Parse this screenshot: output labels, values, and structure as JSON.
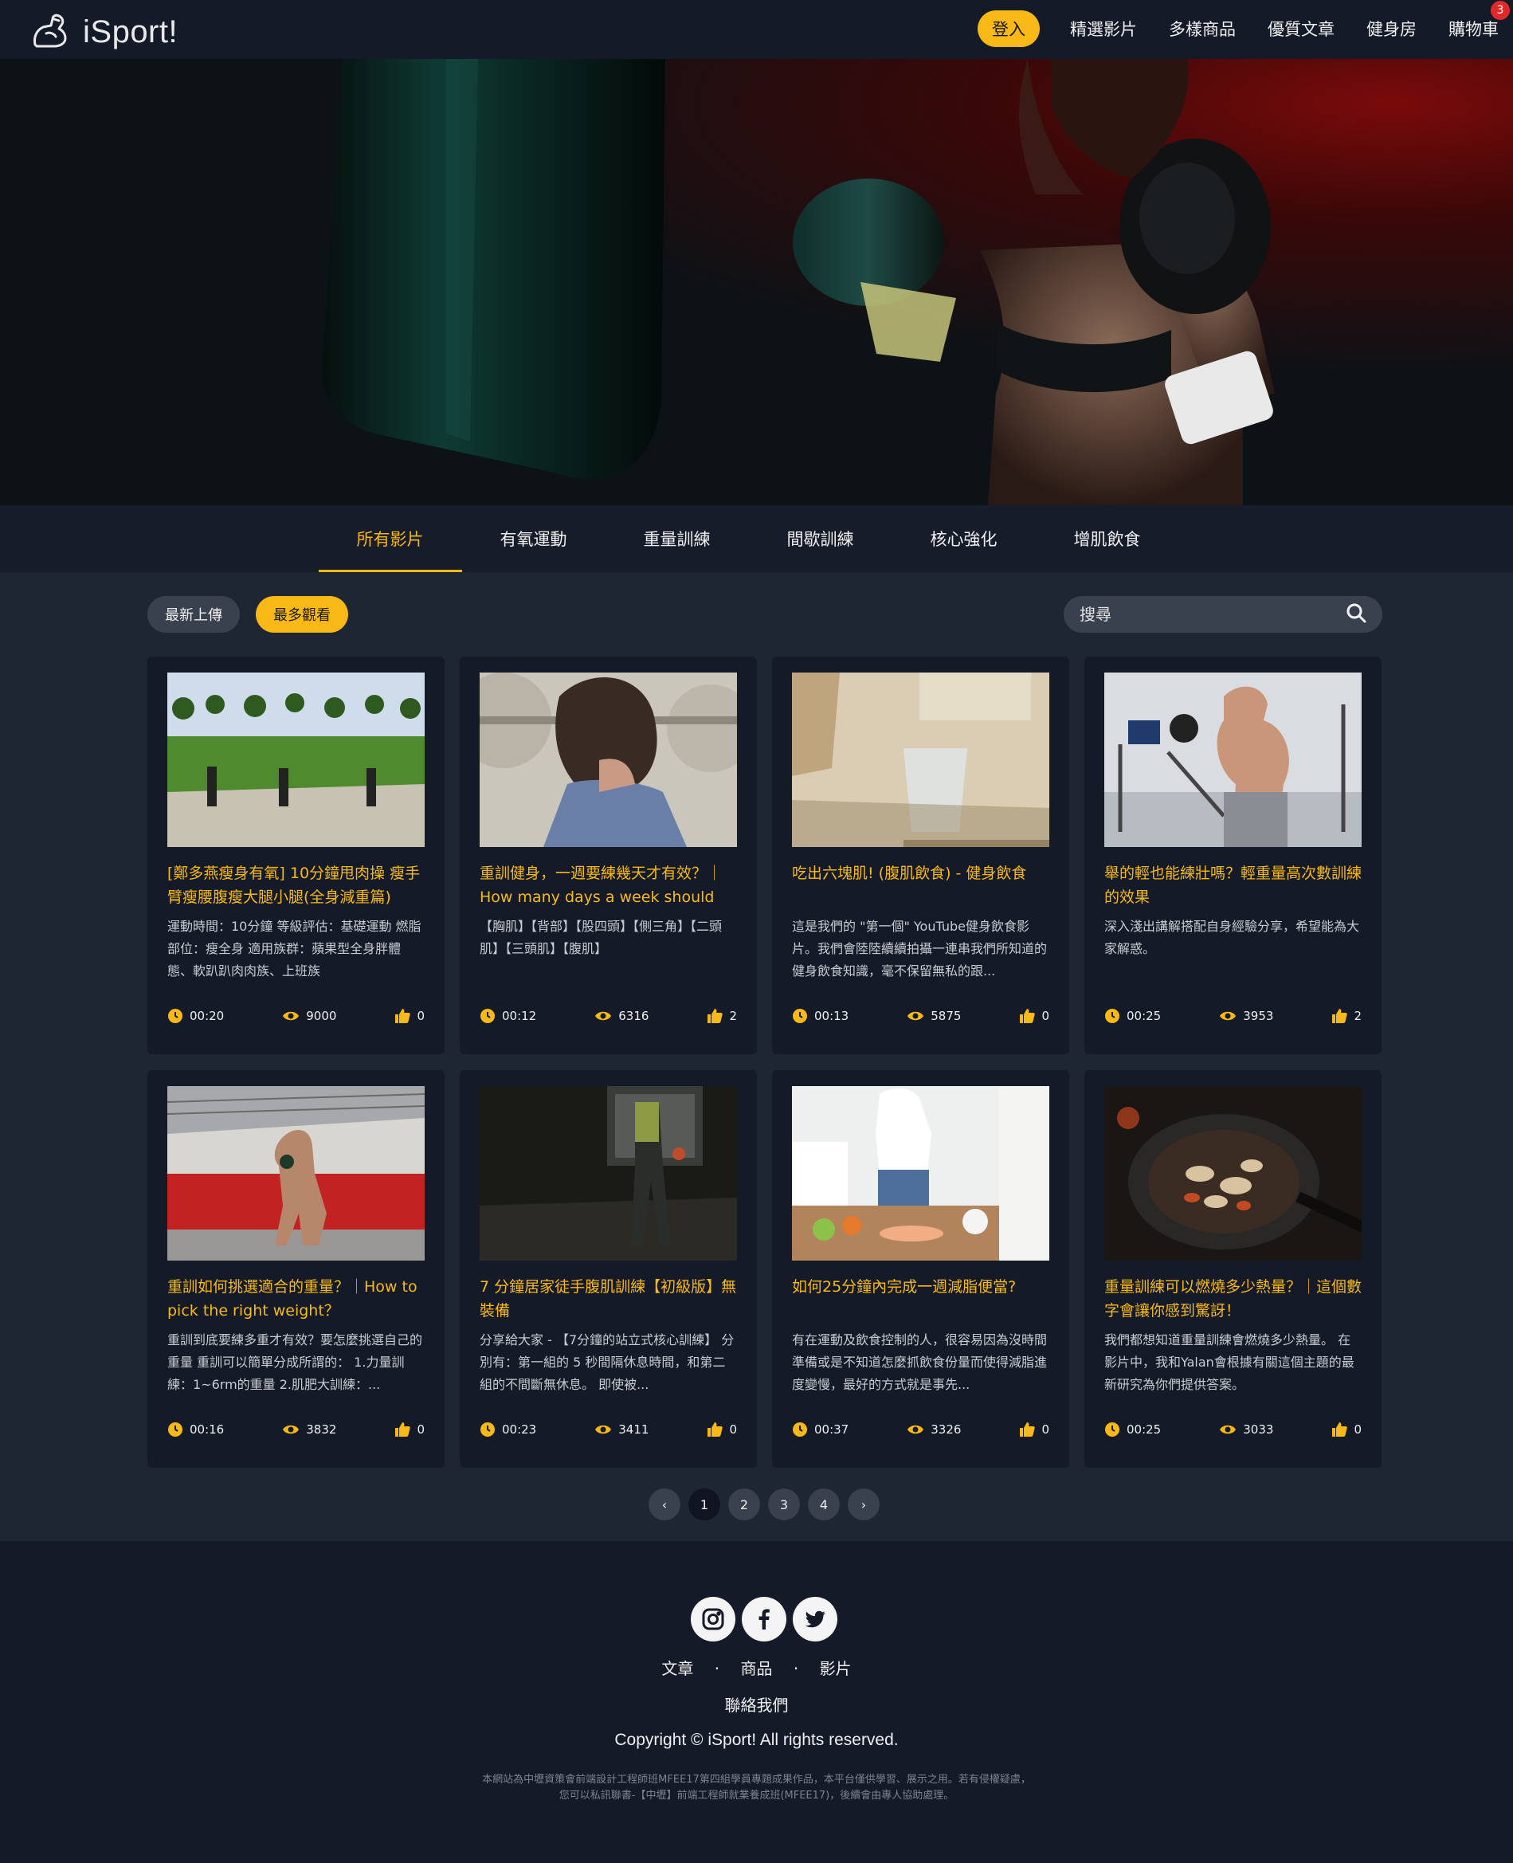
{
  "header": {
    "logo_text": "iSport!",
    "login_label": "登入",
    "nav": [
      "精選影片",
      "多樣商品",
      "優質文章",
      "健身房",
      "購物車"
    ],
    "cart_count": "3"
  },
  "tabs": [
    {
      "label": "所有影片",
      "active": true
    },
    {
      "label": "有氧運動",
      "active": false
    },
    {
      "label": "重量訓練",
      "active": false
    },
    {
      "label": "間歇訓練",
      "active": false
    },
    {
      "label": "核心強化",
      "active": false
    },
    {
      "label": "增肌飲食",
      "active": false
    }
  ],
  "filters": {
    "latest": "最新上傳",
    "most_viewed": "最多觀看"
  },
  "search": {
    "placeholder": "搜尋"
  },
  "colors": {
    "accent": "#f8b916",
    "card_bg": "#141a27",
    "page_bg": "#1e2533",
    "badge": "#e02a2a"
  },
  "videos": [
    {
      "title": "[鄭多燕瘦身有氧] 10分鐘甩肉操 瘦手臂瘦腰腹瘦大腿小腿(全身減重篇)",
      "desc": "運動時間：10分鐘 等級評估：基礎運動 燃脂部位：瘦全身 適用族群：蘋果型全身胖體態、軟趴趴肉肉族、上班族",
      "duration": "00:20",
      "views": "9000",
      "likes": "0"
    },
    {
      "title": "重訓健身，一週要練幾天才有效？｜How many days a week should I...",
      "desc": "【胸肌】【背部】【股四頭】【側三角】【二頭肌】【三頭肌】【腹肌】",
      "duration": "00:12",
      "views": "6316",
      "likes": "2"
    },
    {
      "title": "吃出六塊肌! (腹肌飲食) - 健身飲食",
      "desc": "這是我們的 \"第一個\" YouTube健身飲食影片。我們會陸陸續續拍攝一連串我們所知道的健身飲食知識，毫不保留無私的跟...",
      "duration": "00:13",
      "views": "5875",
      "likes": "0"
    },
    {
      "title": "舉的輕也能練壯嗎？輕重量高次數訓練的效果",
      "desc": "深入淺出講解搭配自身經驗分享，希望能為大家解惑。",
      "duration": "00:25",
      "views": "3953",
      "likes": "2"
    },
    {
      "title": "重訓如何挑選適合的重量？｜How to pick the right weight？",
      "desc": "重訓到底要練多重才有效？要怎麼挑選自己的重量 重訓可以簡單分成所謂的： 1.力量訓練：1~6rm的重量 2.肌肥大訓練：...",
      "duration": "00:16",
      "views": "3832",
      "likes": "0"
    },
    {
      "title": "7 分鐘居家徒手腹肌訓練【初級版】無裝備",
      "desc": "分享給大家 - 【7分鐘的站立式核心訓練】 分別有：第一組的 5 秒間隔休息時間，和第二組的不間斷無休息。 即使被...",
      "duration": "00:23",
      "views": "3411",
      "likes": "0"
    },
    {
      "title": "如何25分鐘內完成一週減脂便當?",
      "desc": "有在運動及飲食控制的人，很容易因為沒時間準備或是不知道怎麼抓飲食份量而使得減脂進度變慢，最好的方式就是事先...",
      "duration": "00:37",
      "views": "3326",
      "likes": "0"
    },
    {
      "title": "重量訓練可以燃燒多少熱量？｜這個數字會讓你感到驚訝！",
      "desc": "我們都想知道重量訓練會燃燒多少熱量。 在影片中，我和Yalan會根據有關這個主題的最新研究為你們提供答案。",
      "duration": "00:25",
      "views": "3033",
      "likes": "0"
    }
  ],
  "pagination": {
    "pages": [
      "1",
      "2",
      "3",
      "4"
    ],
    "current": "1",
    "prev": "‹",
    "next": "›"
  },
  "footer": {
    "links": [
      "文章",
      "商品",
      "影片"
    ],
    "separator": "·",
    "contact": "聯絡我們",
    "copyright": "Copyright © iSport! All rights reserved.",
    "disclaimer": "本網站為中壢資策會前端設計工程師班MFEE17第四組學員專題成果作品，本平台僅供學習、展示之用。若有侵權疑慮，您可以私訊聯書-【中壢】前端工程師就業養成班(MFEE17)，後續會由專人協助處理。"
  }
}
